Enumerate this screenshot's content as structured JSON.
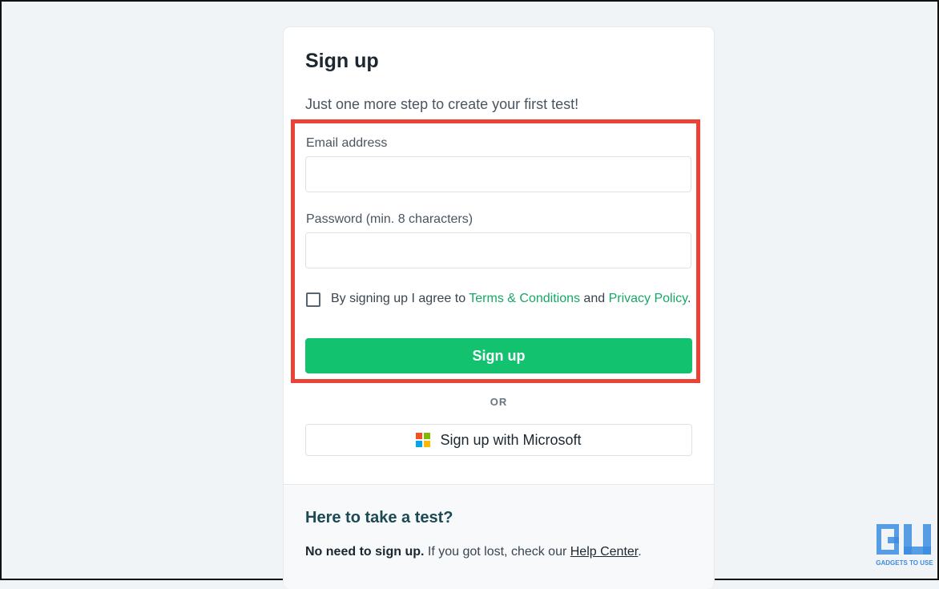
{
  "signup": {
    "title": "Sign up",
    "subtitle": "Just one more step to create your first test!",
    "email_label": "Email address",
    "email_value": "",
    "password_label": "Password (min. 8 characters)",
    "password_value": "",
    "agree_prefix": "By signing up I agree to ",
    "terms_link": "Terms & Conditions",
    "agree_middle": " and ",
    "privacy_link": "Privacy Policy",
    "agree_suffix": ".",
    "terms_checked": false,
    "submit_label": "Sign up",
    "or_label": "OR",
    "microsoft_label": "Sign up with Microsoft"
  },
  "footer": {
    "title": "Here to take a test?",
    "bold_text": "No need to sign up.",
    "text": " If you got lost, check our ",
    "help_link": "Help Center",
    "suffix": "."
  },
  "watermark": {
    "text": "GADGETS TO USE"
  },
  "colors": {
    "accent": "#13c26f",
    "link": "#16a865",
    "highlight": "#ea4335",
    "page_bg": "#f1f4f7"
  },
  "icons": {
    "microsoft": "microsoft-logo-icon",
    "checkbox": "checkbox-unchecked"
  }
}
